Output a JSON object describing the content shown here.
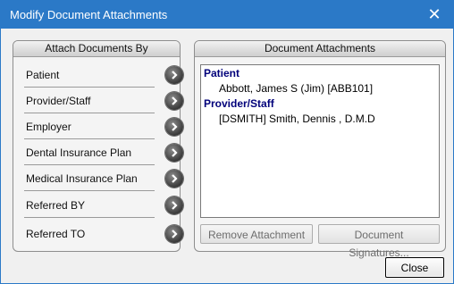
{
  "window": {
    "title": "Modify Document Attachments",
    "close_glyph": "✕"
  },
  "left_panel": {
    "header": "Attach Documents By",
    "items": [
      {
        "label": "Patient"
      },
      {
        "label": "Provider/Staff"
      },
      {
        "label": "Employer"
      },
      {
        "label": "Dental Insurance Plan"
      },
      {
        "label": "Medical Insurance Plan"
      },
      {
        "label": "Referred BY"
      },
      {
        "label": "Referred TO"
      }
    ],
    "arrow_icon": "chevron-right-icon"
  },
  "right_panel": {
    "header": "Document Attachments",
    "groups": [
      {
        "title": "Patient",
        "entries": [
          "Abbott, James S (Jim) [ABB101]"
        ]
      },
      {
        "title": "Provider/Staff",
        "entries": [
          "[DSMITH] Smith, Dennis , D.M.D"
        ]
      }
    ],
    "remove_label": "Remove Attachment",
    "signatures_label": "Document Signatures..."
  },
  "footer": {
    "close_label": "Close"
  },
  "colors": {
    "titlebar": "#2b79c7",
    "group_title": "#00007a"
  }
}
